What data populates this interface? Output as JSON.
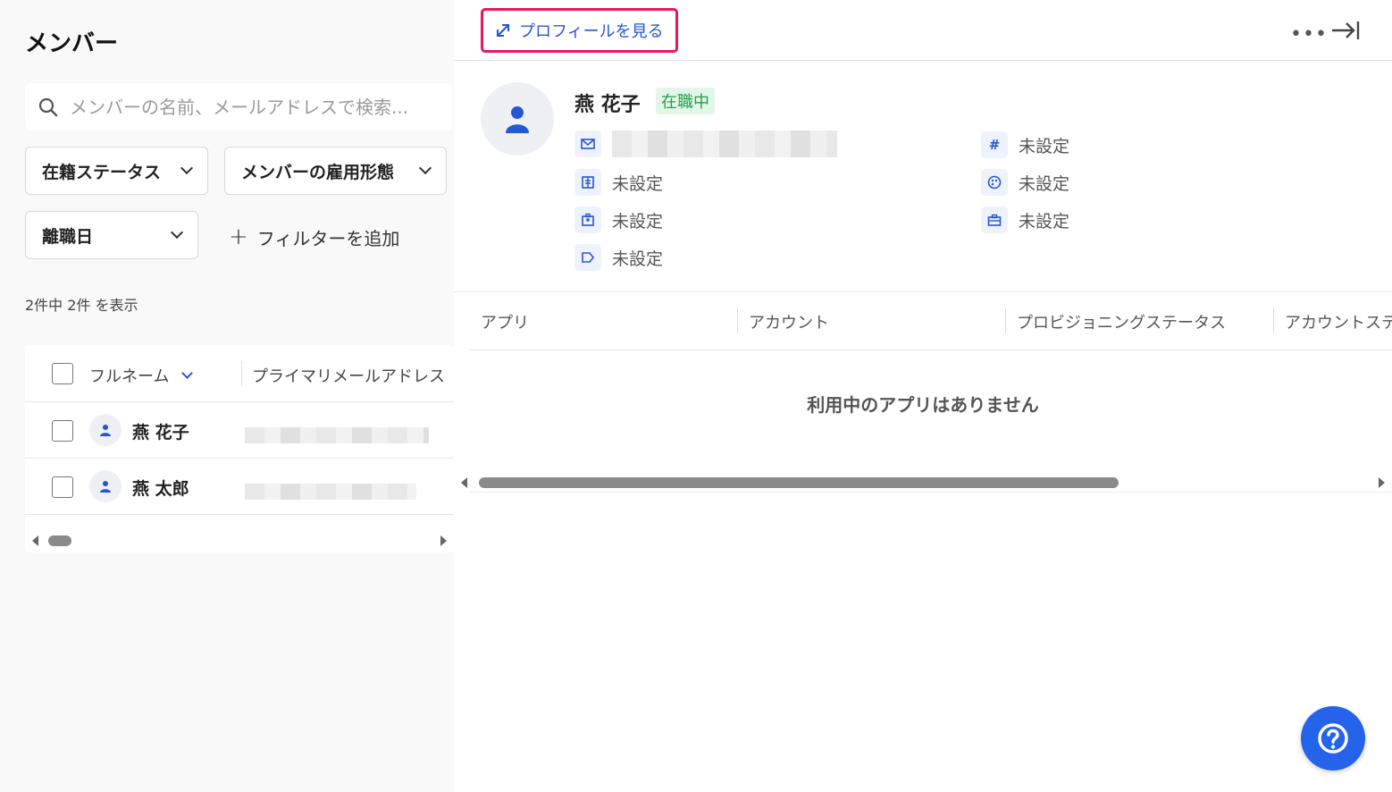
{
  "page": {
    "title": "メンバー"
  },
  "search": {
    "placeholder": "メンバーの名前、メールアドレスで検索..."
  },
  "filters": [
    {
      "label": "在籍ステータス"
    },
    {
      "label": "メンバーの雇用形態"
    },
    {
      "label": "離職日"
    }
  ],
  "add_filter": {
    "label": "フィルターを追加"
  },
  "result_count": "2件中 2件 を表示",
  "members_table": {
    "columns": [
      "フルネーム",
      "プライマリメールアドレス"
    ],
    "rows": [
      {
        "name": "燕 花子"
      },
      {
        "name": "燕 太郎"
      }
    ]
  },
  "detail": {
    "view_profile_label": "プロフィールを見る",
    "name": "燕 花子",
    "status": "在職中",
    "fields_left": [
      {
        "icon": "mail-icon",
        "value": ""
      },
      {
        "icon": "building-icon",
        "value": "未設定"
      },
      {
        "icon": "id-card-icon",
        "value": "未設定"
      },
      {
        "icon": "tag-icon",
        "value": "未設定"
      }
    ],
    "fields_right": [
      {
        "icon": "hash-icon",
        "value": "未設定"
      },
      {
        "icon": "palette-icon",
        "value": "未設定"
      },
      {
        "icon": "briefcase-icon",
        "value": "未設定"
      }
    ],
    "apps_columns": [
      "アプリ",
      "アカウント",
      "プロビジョニングステータス",
      "アカウントステ"
    ],
    "apps_empty": "利用中のアプリはありません"
  },
  "colors": {
    "accent": "#2457d6",
    "highlight": "#e8175d",
    "status_bg": "#e4f6e8",
    "status_text": "#1f9e4b",
    "help_button": "#2563eb"
  }
}
